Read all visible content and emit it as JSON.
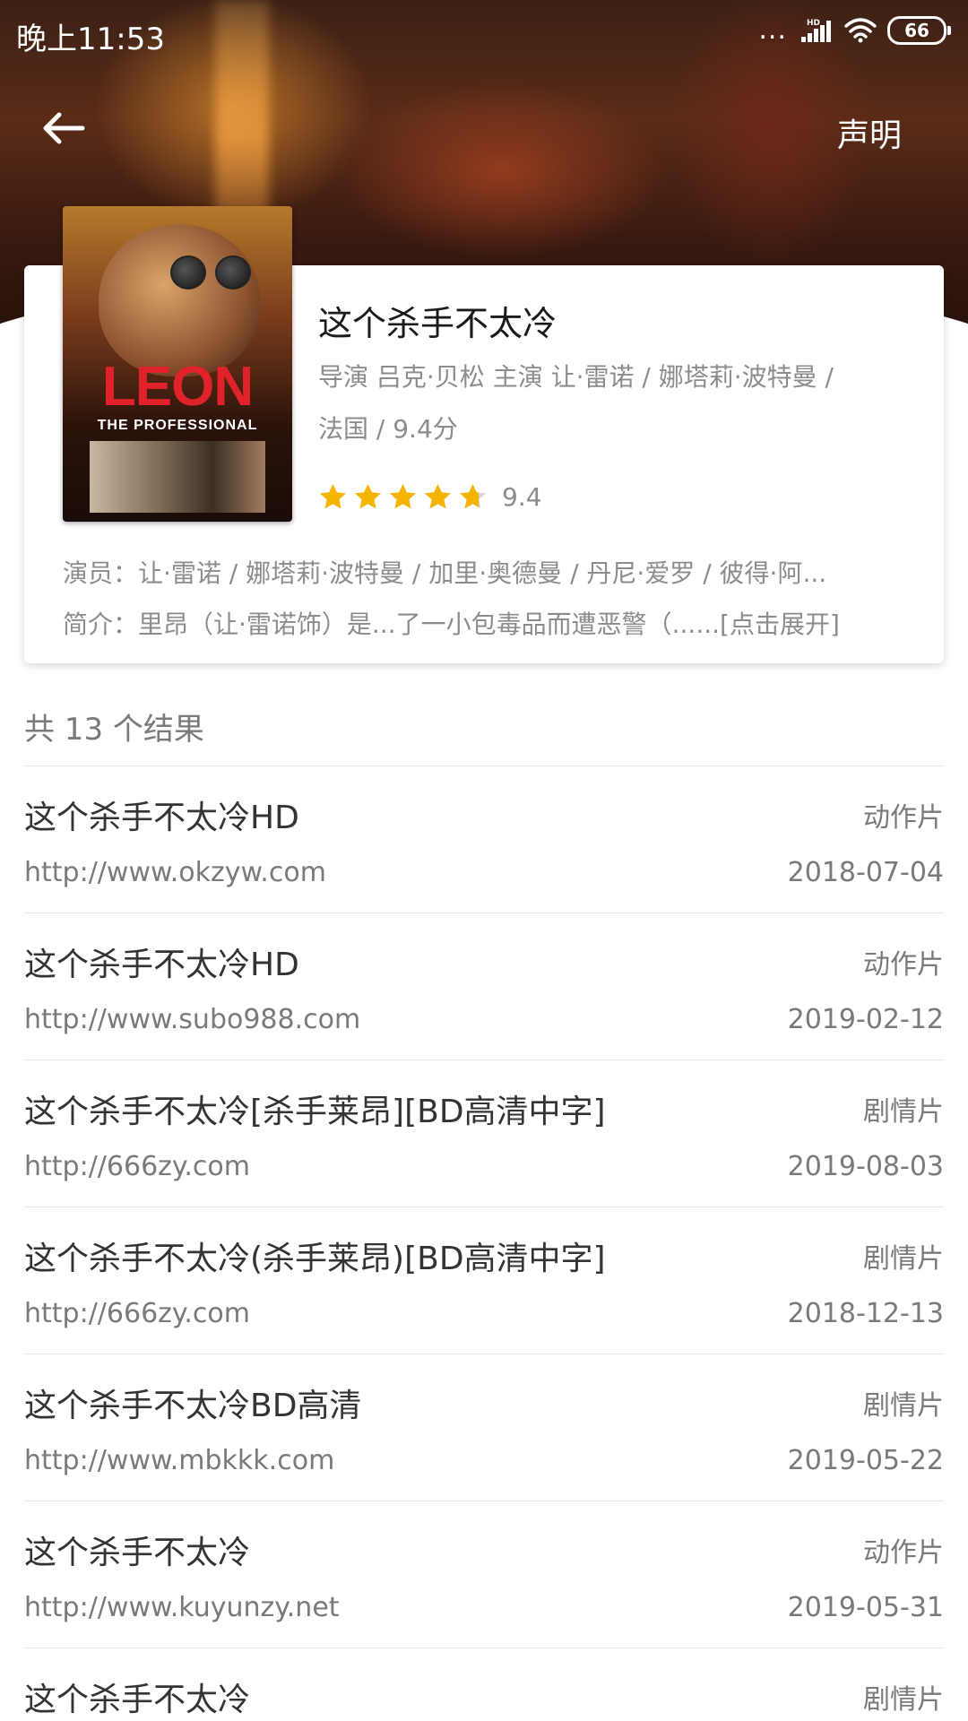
{
  "status_bar": {
    "time": "晚上11:53",
    "signal_dots": "...",
    "network_badge": "HD",
    "battery": "66"
  },
  "nav": {
    "back_icon": "arrow-left-icon",
    "declare_label": "声明"
  },
  "movie": {
    "title": "这个杀手不太冷",
    "meta_line_1": "导演 吕克·贝松 主演 让·雷诺 / 娜塔莉·波特曼 /",
    "meta_line_2": "法国 / 9.4分",
    "rating": "9.4",
    "rating_stars": 4.7,
    "cast": "演员：让·雷诺 / 娜塔莉·波特曼 / 加里·奥德曼 / 丹尼·爱罗 / 彼得·阿...",
    "intro": "简介：里昂（让·雷诺饰）是...了一小包毒品而遭恶警（...",
    "expand_label": "...[点击展开]",
    "poster": {
      "title": "LEON",
      "subtitle": "THE PROFESSIONAL"
    }
  },
  "results": {
    "count_label": "共 13 个结果",
    "items": [
      {
        "title": "这个杀手不太冷HD",
        "genre": "动作片",
        "url": "http://www.okzyw.com",
        "date": "2018-07-04"
      },
      {
        "title": "这个杀手不太冷HD",
        "genre": "动作片",
        "url": "http://www.subo988.com",
        "date": "2019-02-12"
      },
      {
        "title": "这个杀手不太冷[杀手莱昂][BD高清中字]",
        "genre": "剧情片",
        "url": "http://666zy.com",
        "date": "2019-08-03"
      },
      {
        "title": "这个杀手不太冷(杀手莱昂)[BD高清中字]",
        "genre": "剧情片",
        "url": "http://666zy.com",
        "date": "2018-12-13"
      },
      {
        "title": "这个杀手不太冷BD高清",
        "genre": "剧情片",
        "url": "http://www.mbkkk.com",
        "date": "2019-05-22"
      },
      {
        "title": "这个杀手不太冷",
        "genre": "动作片",
        "url": "http://www.kuyunzy.net",
        "date": "2019-05-31"
      },
      {
        "title": "这个杀手不太冷",
        "genre": "剧情片",
        "url": "",
        "date": ""
      }
    ]
  },
  "colors": {
    "star_fill": "#f5b400",
    "star_empty": "#d9d9d9",
    "text_primary": "#333333",
    "text_secondary": "#8c8c8c",
    "poster_title": "#e0232b"
  }
}
